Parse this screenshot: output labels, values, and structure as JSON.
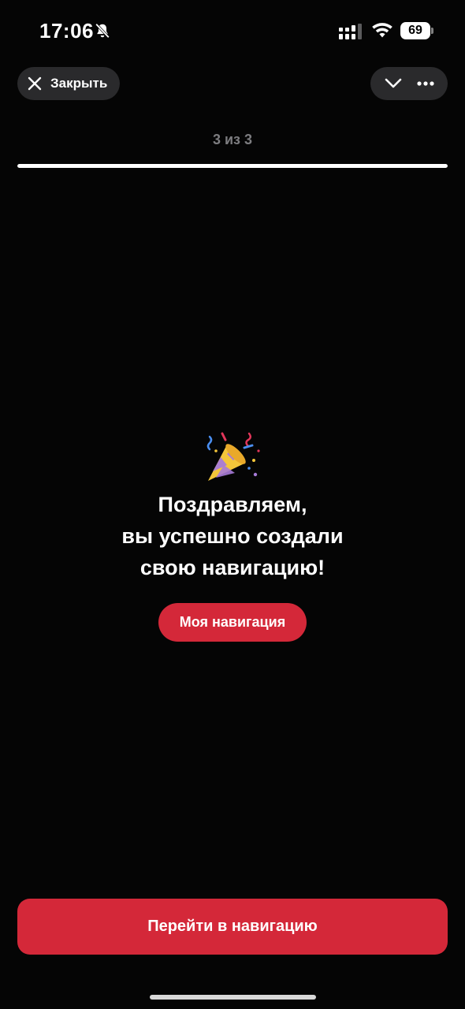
{
  "status_bar": {
    "time": "17:06",
    "battery": "69",
    "icons": [
      "bell-muted-icon",
      "cellular-signal-icon",
      "wifi-icon",
      "battery-icon"
    ]
  },
  "header": {
    "close_label": "Закрыть",
    "close_icon": "close-icon",
    "collapse_icon": "chevron-down-icon",
    "more_icon": "more-horizontal-icon"
  },
  "progress": {
    "label": "3 из 3",
    "current": 3,
    "total": 3
  },
  "main": {
    "emoji_icon": "party-popper-icon",
    "headline_lines": [
      "Поздравляем,",
      "вы успешно создали",
      "свою навигацию!"
    ],
    "my_navigation_label": "Моя навигация"
  },
  "footer": {
    "cta_label": "Перейти в навигацию"
  },
  "colors": {
    "background": "#050505",
    "accent": "#d42839",
    "pill": "#2a2a2c",
    "muted_text": "#7d7d80"
  }
}
